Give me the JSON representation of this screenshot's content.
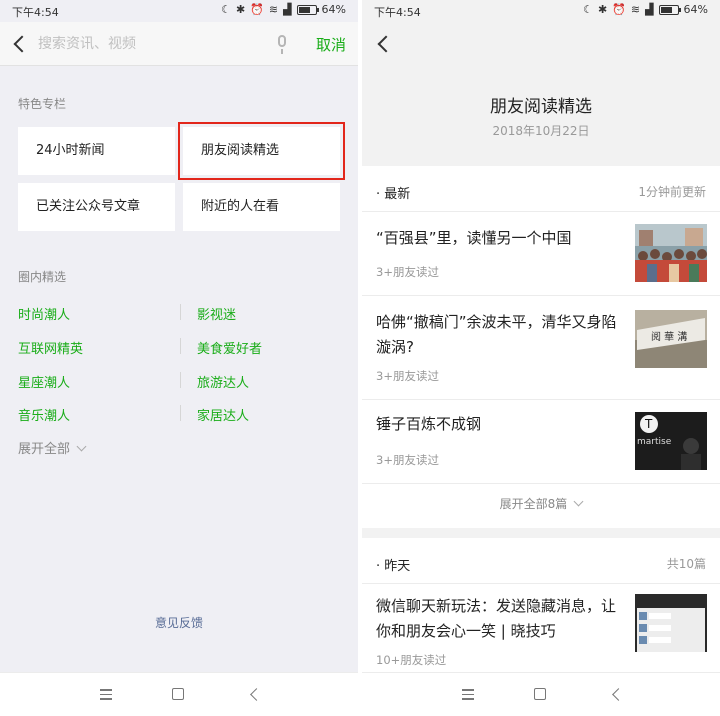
{
  "status_bar": {
    "time": "下午4:54",
    "battery": "64%"
  },
  "search": {
    "placeholder": "搜索资讯、视频",
    "cancel_label": "取消"
  },
  "featured": {
    "label": "特色专栏",
    "tiles": [
      "24小时新闻",
      "朋友阅读精选",
      "已关注公众号文章",
      "附近的人在看"
    ]
  },
  "circle": {
    "label": "圈内精选",
    "items": [
      "时尚潮人",
      "影视迷",
      "互联网精英",
      "美食爱好者",
      "星座潮人",
      "旅游达人",
      "音乐潮人",
      "家居达人"
    ],
    "expand_label": "展开全部"
  },
  "feedback_label": "意见反馈",
  "detail": {
    "title": "朋友阅读精选",
    "date": "2018年10月22日",
    "latest": {
      "label": "· 最新",
      "meta": "1分钟前更新",
      "articles": [
        {
          "title": "“百强县”里，读懂另一个中国",
          "readers": "3+朋友读过"
        },
        {
          "title": "哈佛“撤稿门”余波未平，清华又身陷漩涡?",
          "readers": "3+朋友读过"
        },
        {
          "title": "锤子百炼不成钢",
          "readers": "3+朋友读过"
        }
      ],
      "expand_label": "展开全部8篇"
    },
    "yesterday": {
      "label": "· 昨天",
      "meta": "共10篇",
      "articles": [
        {
          "title": "微信聊天新玩法：发送隐藏消息，让你和朋友会心一笑 | 晓技巧",
          "readers": "10+朋友读过"
        }
      ]
    }
  },
  "thumb_text": {
    "sign": "阅 華 溝",
    "brand": "martise",
    "tee": "T"
  },
  "colors": {
    "accent_green": "#1aad19",
    "highlight_red": "#e2261b",
    "link_blue": "#576b95"
  }
}
